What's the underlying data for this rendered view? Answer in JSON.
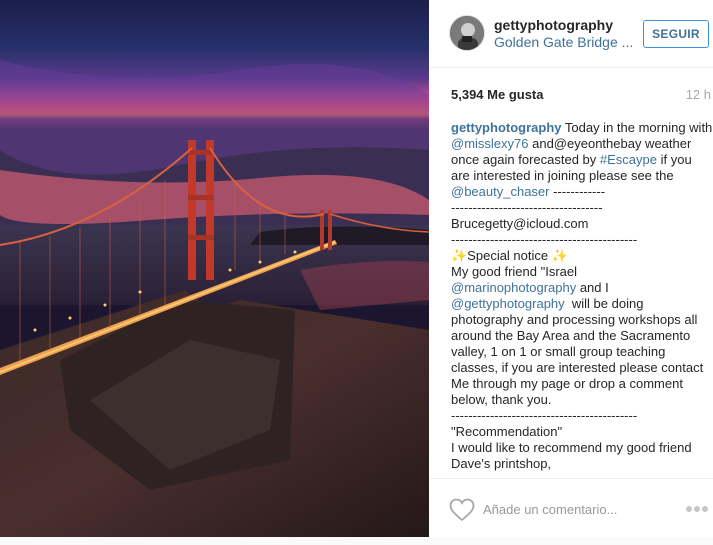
{
  "post": {
    "username": "gettyphotography",
    "location": "Golden Gate Bridge ...",
    "follow_label": "SEGUIR",
    "likes": "5,394 Me gusta",
    "time": "12 h",
    "comment_placeholder": "Añade un comentario...",
    "caption_user": "gettyphotography",
    "caption_parts": [
      {
        "t": " Today in the morning with ",
        "m": false
      },
      {
        "t": "@misslexy76",
        "m": true
      },
      {
        "t": " and@eyeonthebay weather once again forecasted by ",
        "m": false
      },
      {
        "t": "#Escaype",
        "m": true
      },
      {
        "t": " if you are interested in joining please see the ",
        "m": false
      },
      {
        "t": "@beauty_chaser",
        "m": true
      },
      {
        "t": " ------------\n-----------------------------------\nBrucegetty@icloud.com\n-------------------------------------------\n✨Special notice ✨\nMy good friend \"Israel\n",
        "m": false
      },
      {
        "t": "@marinophotography",
        "m": true
      },
      {
        "t": " and I\n",
        "m": false
      },
      {
        "t": "@gettyphotography",
        "m": true
      },
      {
        "t": "  will be doing photography and processing workshops all around the Bay Area and the Sacramento valley, 1 on 1 or small group teaching classes, if you are interested please contact Me through my page or drop a comment below, thank you.\n-------------------------------------------\n\"Recommendation\"\nI would like to recommend my good friend Dave's printshop,",
        "m": false
      }
    ]
  },
  "icons": {
    "heart": "heart-icon",
    "more": "more-options-icon"
  },
  "colors": {
    "link": "#3f729b",
    "follow_border": "#4090db",
    "muted": "#a5a7aa"
  }
}
